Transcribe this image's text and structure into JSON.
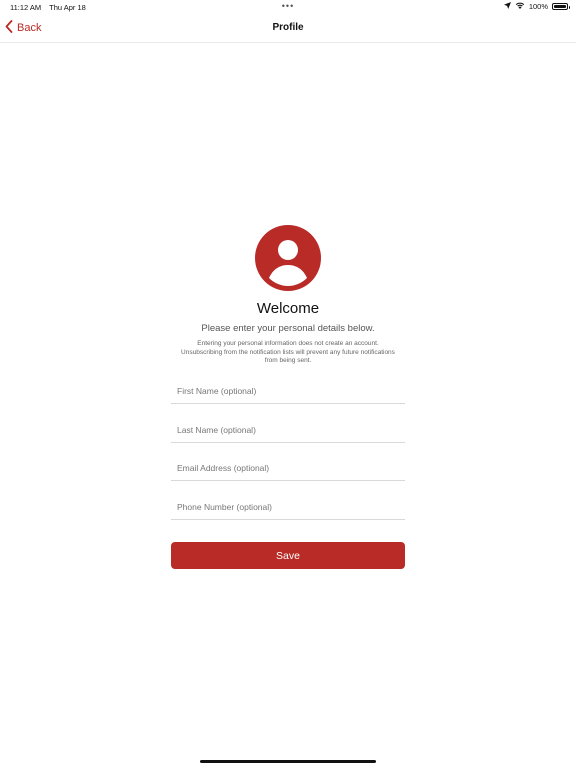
{
  "status_bar": {
    "time": "11:12 AM",
    "date": "Thu Apr 18",
    "center_dots": "•••",
    "battery_percent": "100%"
  },
  "nav": {
    "back_label": "Back",
    "title": "Profile"
  },
  "welcome": {
    "heading": "Welcome",
    "subtitle": "Please enter your personal details below.",
    "disclaimer": "Entering your personal information does not create an account. Unsubscribing from the notification lists will prevent any future notifications from being sent."
  },
  "form": {
    "first_name": {
      "value": "",
      "placeholder": "First Name (optional)"
    },
    "last_name": {
      "value": "",
      "placeholder": "Last Name (optional)"
    },
    "email": {
      "value": "",
      "placeholder": "Email Address (optional)"
    },
    "phone": {
      "value": "",
      "placeholder": "Phone Number (optional)"
    },
    "save_label": "Save"
  },
  "colors": {
    "accent": "#b92b27",
    "text": "#111111",
    "muted": "#777777",
    "divider": "#d9d9d9"
  },
  "icons": {
    "back": "chevron-left-icon",
    "avatar": "person-icon",
    "location": "location-arrow-icon",
    "wifi": "wifi-icon",
    "battery": "battery-icon"
  }
}
